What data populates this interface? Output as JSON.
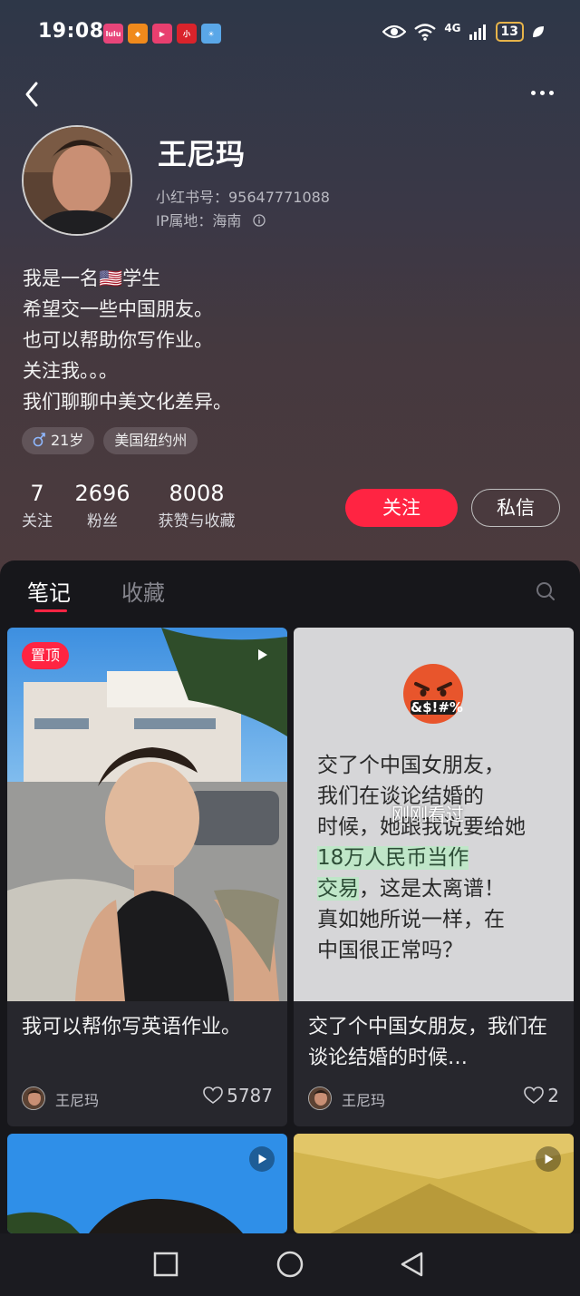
{
  "status_bar": {
    "time": "19:08",
    "app_icons": [
      "lulu",
      "shield",
      "play",
      "mi",
      "sun"
    ],
    "network": "4G",
    "battery": "13"
  },
  "profile": {
    "name": "王尼玛",
    "id_line": "小红书号：95647771088",
    "ip_line": "IP属地：海南",
    "bio": [
      "我是一名🇺🇸学生",
      "希望交一些中国朋友。",
      "也可以帮助你写作业。",
      "关注我。。。",
      "我们聊聊中美文化差异。"
    ],
    "tags": [
      "21岁",
      "美国纽约州"
    ],
    "stats": [
      {
        "num": "7",
        "label": "关注"
      },
      {
        "num": "2696",
        "label": "粉丝"
      },
      {
        "num": "8008",
        "label": "获赞与收藏"
      }
    ],
    "follow_label": "关注",
    "message_label": "私信"
  },
  "tabs": {
    "notes": "笔记",
    "favorites": "收藏"
  },
  "notes": [
    {
      "badge": "置顶",
      "title": "我可以帮你写英语作业。",
      "author": "王尼玛",
      "likes": "5787"
    },
    {
      "emoji_caption": "&$!#%",
      "text_lines_before": [
        "交了个中国女朋友，",
        "我们在谈论结婚的",
        "时候，她跟我说要给她"
      ],
      "highlight": [
        "18万人民币当作",
        "交易"
      ],
      "text_after_first": "，这是太离谱！",
      "text_lines_after": [
        "真如她所说一样，在",
        "中国很正常吗？"
      ],
      "overlay": "刚刚看过",
      "title": "交了个中国女朋友，我们在谈论结婚的时候…",
      "author": "王尼玛",
      "likes": "2"
    }
  ],
  "colors": {
    "accent": "#ff2442",
    "bg": "#17171b",
    "card": "#27272d"
  }
}
